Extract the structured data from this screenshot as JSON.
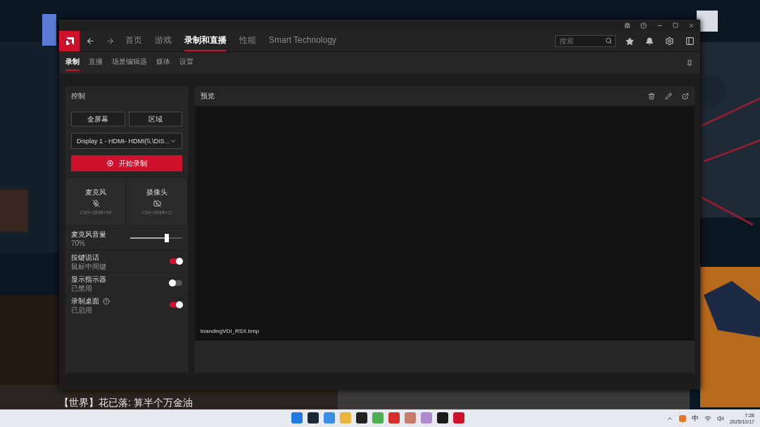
{
  "game": {
    "chat": [
      "【世界】花已落: 算半个万金油"
    ]
  },
  "window": {
    "nav": {
      "tabs": [
        {
          "label": "首页",
          "selected": false
        },
        {
          "label": "游戏",
          "selected": false
        },
        {
          "label": "录制和直播",
          "selected": true
        },
        {
          "label": "性能",
          "selected": false
        },
        {
          "label": "Smart Technology",
          "selected": false
        }
      ],
      "search": {
        "placeholder": "搜索"
      }
    },
    "subnav": {
      "tabs": [
        {
          "label": "录制",
          "selected": true
        },
        {
          "label": "直播",
          "selected": false
        },
        {
          "label": "场景编辑器",
          "selected": false
        },
        {
          "label": "媒体",
          "selected": false
        },
        {
          "label": "设置",
          "selected": false
        }
      ]
    },
    "control_panel": {
      "title": "控制",
      "modes": [
        {
          "label": "全屏幕",
          "selected": true
        },
        {
          "label": "区域",
          "selected": false
        }
      ],
      "display_select": {
        "value": "Display 1 - HDMI- HDMI(\\\\.\\DIS..."
      },
      "record_button": "开始录制",
      "devices": [
        {
          "kind": "mic",
          "label": "麦克风",
          "shortcut": "Ctrl+Shift+M",
          "enabled": false
        },
        {
          "kind": "camera",
          "label": "摄像头",
          "shortcut": "Ctrl+Shift+C",
          "enabled": false
        }
      ],
      "volume": {
        "label": "麦克风音量",
        "reading": "70%",
        "level": 0.7
      },
      "toggles": [
        {
          "label": "按键说话",
          "status": "鼠标中间键",
          "on": true,
          "help": false
        },
        {
          "label": "显示指示器",
          "status": "已禁用",
          "on": false,
          "help": false
        },
        {
          "label": "录制桌面",
          "status": "已启用",
          "on": true,
          "help": true
        }
      ]
    },
    "preview": {
      "title": "预览",
      "file": "brandingVDI_RSX.bmp"
    }
  },
  "taskbar": {
    "ime": "中",
    "time": "7:28",
    "date": "2025/10/17"
  }
}
